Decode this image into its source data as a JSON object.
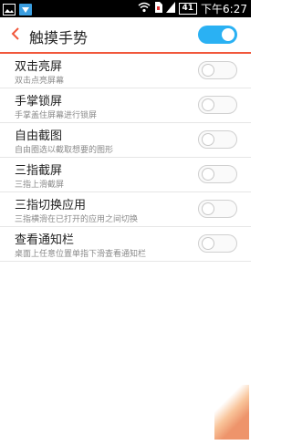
{
  "status_bar": {
    "battery": "41",
    "time": "下午6:27"
  },
  "header": {
    "title": "触摸手势",
    "master_toggle_on": true
  },
  "items": [
    {
      "title": "双击亮屏",
      "subtitle": "双击点亮屏幕",
      "on": false
    },
    {
      "title": "手掌锁屏",
      "subtitle": "手掌盖住屏幕进行锁屏",
      "on": false
    },
    {
      "title": "自由截图",
      "subtitle": "自由圈选以截取想要的图形",
      "on": false
    },
    {
      "title": "三指截屏",
      "subtitle": "三指上滑截屏",
      "on": false
    },
    {
      "title": "三指切换应用",
      "subtitle": "三指横滑在已打开的应用之间切换",
      "on": false
    },
    {
      "title": "查看通知栏",
      "subtitle": "桌面上任意位置单指下滑查看通知栏",
      "on": false
    }
  ],
  "colors": {
    "accent": "#f1573b",
    "toggle_on": "#2ab1f3"
  }
}
